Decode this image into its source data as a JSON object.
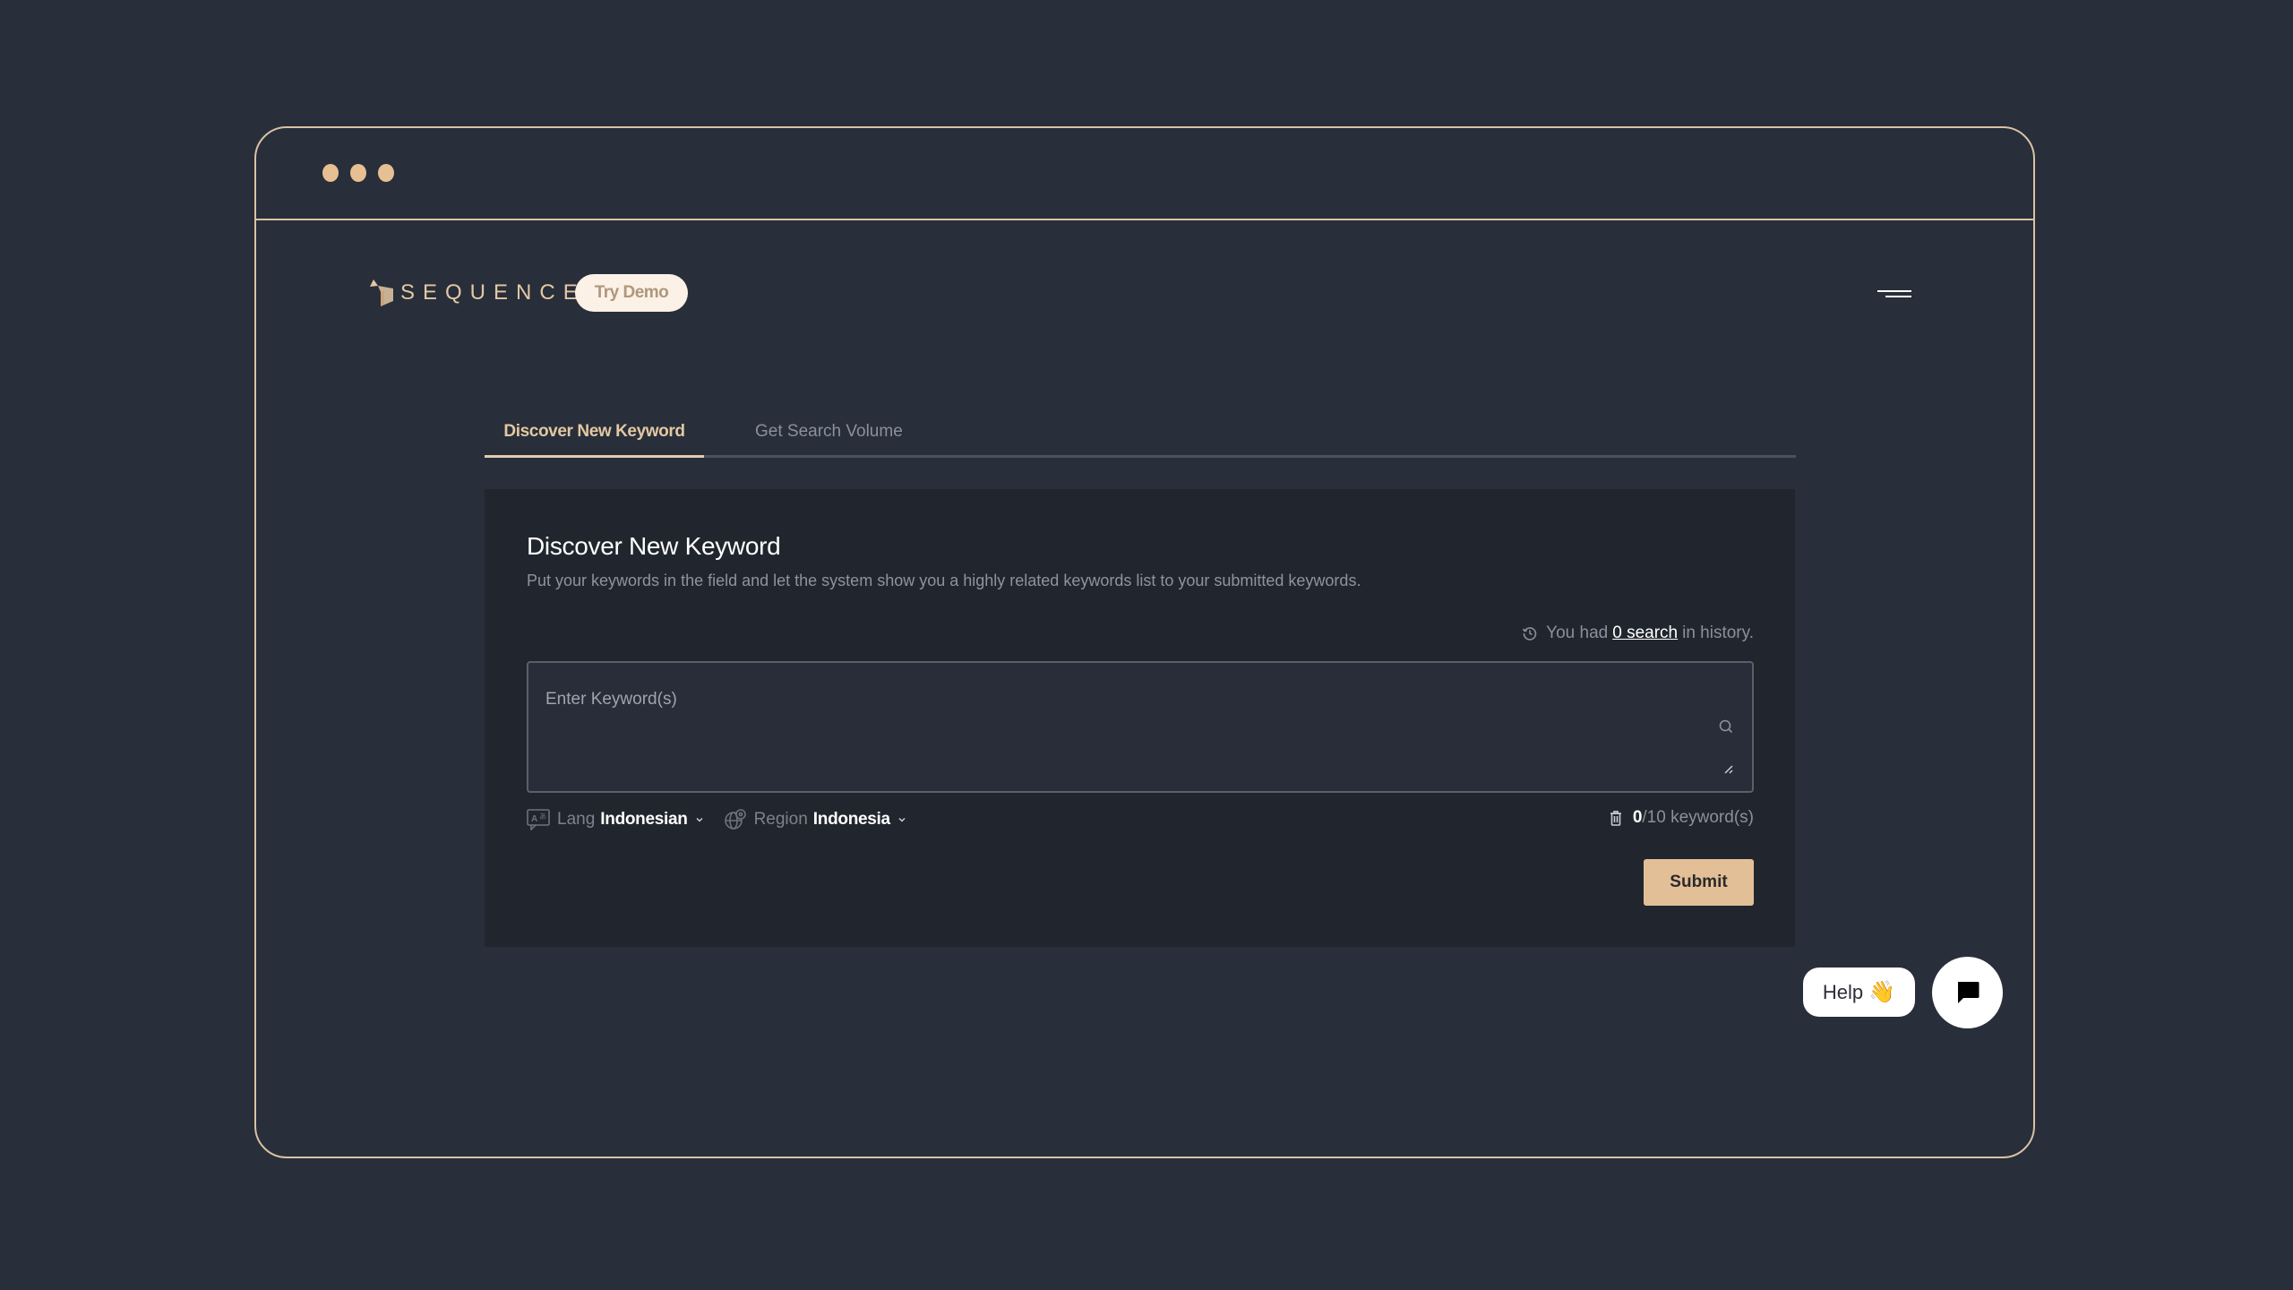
{
  "window": {
    "controls": [
      "dot",
      "dot",
      "dot"
    ]
  },
  "header": {
    "logo_text": "SEQUENCE",
    "try_demo_label": "Try Demo",
    "menu_icon": "hamburger-menu-icon"
  },
  "tabs": [
    {
      "label": "Discover New Keyword",
      "active": true
    },
    {
      "label": "Get Search Volume",
      "active": false
    }
  ],
  "card": {
    "title": "Discover New Keyword",
    "description": "Put your keywords in the field and let the system show you a highly related keywords list to your submitted keywords.",
    "history": {
      "prefix": "You had",
      "link": "0 search",
      "suffix": "in history."
    },
    "keyword_input": {
      "placeholder": "Enter Keyword(s)",
      "value": ""
    },
    "lang": {
      "label": "Lang",
      "value": "Indonesian"
    },
    "region": {
      "label": "Region",
      "value": "Indonesia"
    },
    "counter": {
      "current": "0",
      "rest": "/10 keyword(s)"
    },
    "submit_label": "Submit"
  },
  "widgets": {
    "help_label": "Help",
    "help_emoji": "👋"
  },
  "colors": {
    "accent": "#e3bf98",
    "frame_border": "#d9c2a3",
    "background": "#282e3a",
    "card": "#21262e"
  }
}
